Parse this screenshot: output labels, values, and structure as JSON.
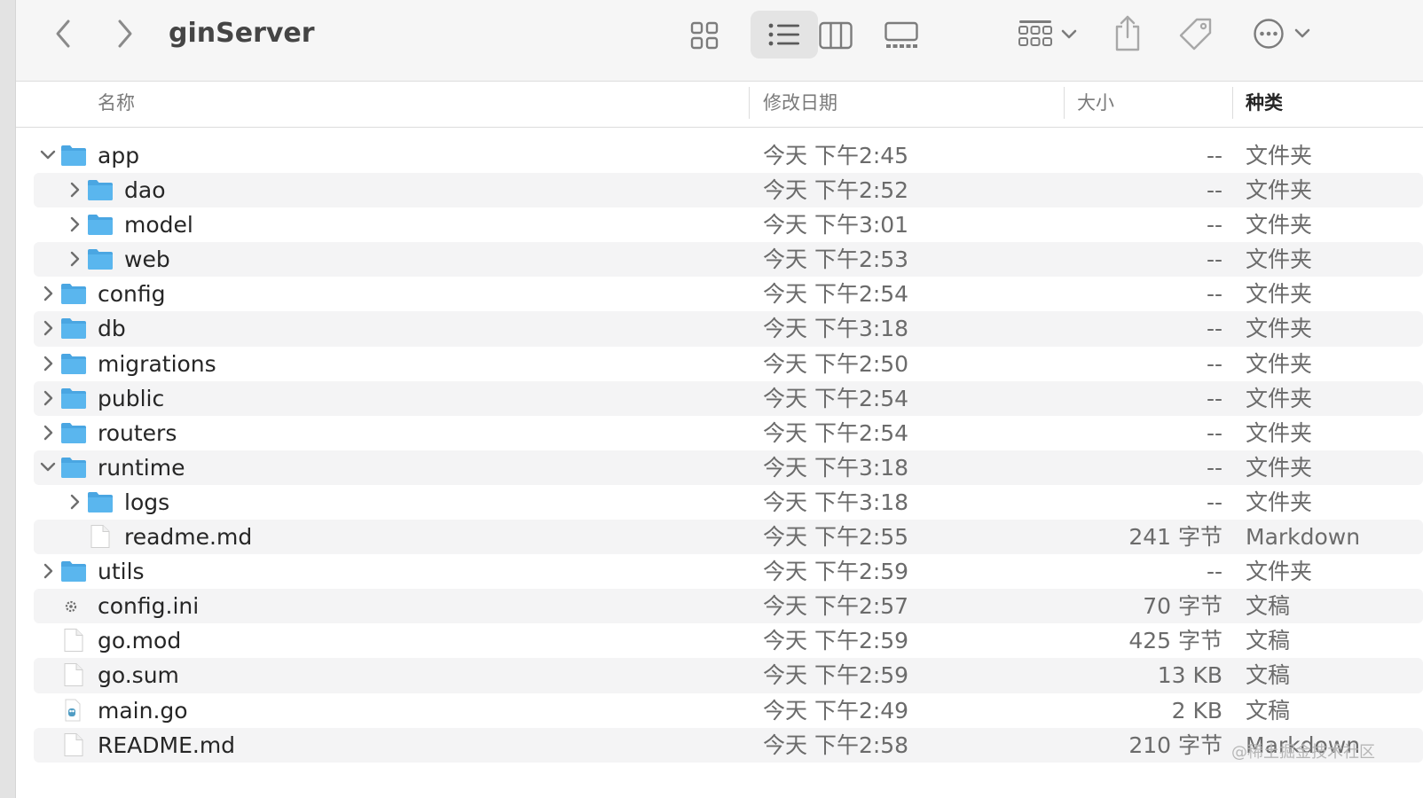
{
  "window": {
    "title": "ginServer"
  },
  "toolbar": {
    "back": "chevron-left-icon",
    "forward": "chevron-right-icon",
    "views": [
      "icon-view-icon",
      "list-view-icon",
      "column-view-icon",
      "gallery-view-icon"
    ],
    "selected_view": "list-view-icon",
    "group": "group-by-icon",
    "share": "share-icon",
    "tags": "tag-icon",
    "more": "more-options-icon"
  },
  "columns": {
    "name": "名称",
    "date": "修改日期",
    "size": "大小",
    "kind": "种类"
  },
  "sorted_column": "kind",
  "colors": {
    "folder": "#5ab6ee",
    "folder_tab": "#4aa6e2",
    "row_alt": "#f4f4f5"
  },
  "files": [
    {
      "name": "app",
      "date": "今天 下午2:45",
      "size": "--",
      "kind": "文件夹",
      "type": "folder",
      "depth": 0,
      "expanded": true
    },
    {
      "name": "dao",
      "date": "今天 下午2:52",
      "size": "--",
      "kind": "文件夹",
      "type": "folder",
      "depth": 1,
      "expanded": false
    },
    {
      "name": "model",
      "date": "今天 下午3:01",
      "size": "--",
      "kind": "文件夹",
      "type": "folder",
      "depth": 1,
      "expanded": false
    },
    {
      "name": "web",
      "date": "今天 下午2:53",
      "size": "--",
      "kind": "文件夹",
      "type": "folder",
      "depth": 1,
      "expanded": false
    },
    {
      "name": "config",
      "date": "今天 下午2:54",
      "size": "--",
      "kind": "文件夹",
      "type": "folder",
      "depth": 0,
      "expanded": false
    },
    {
      "name": "db",
      "date": "今天 下午3:18",
      "size": "--",
      "kind": "文件夹",
      "type": "folder",
      "depth": 0,
      "expanded": false
    },
    {
      "name": "migrations",
      "date": "今天 下午2:50",
      "size": "--",
      "kind": "文件夹",
      "type": "folder",
      "depth": 0,
      "expanded": false
    },
    {
      "name": "public",
      "date": "今天 下午2:54",
      "size": "--",
      "kind": "文件夹",
      "type": "folder",
      "depth": 0,
      "expanded": false
    },
    {
      "name": "routers",
      "date": "今天 下午2:54",
      "size": "--",
      "kind": "文件夹",
      "type": "folder",
      "depth": 0,
      "expanded": false
    },
    {
      "name": "runtime",
      "date": "今天 下午3:18",
      "size": "--",
      "kind": "文件夹",
      "type": "folder",
      "depth": 0,
      "expanded": true
    },
    {
      "name": "logs",
      "date": "今天 下午3:18",
      "size": "--",
      "kind": "文件夹",
      "type": "folder",
      "depth": 1,
      "expanded": false
    },
    {
      "name": "readme.md",
      "date": "今天 下午2:55",
      "size": "241 字节",
      "kind": "Markdown",
      "type": "doc",
      "depth": 1
    },
    {
      "name": "utils",
      "date": "今天 下午2:59",
      "size": "--",
      "kind": "文件夹",
      "type": "folder",
      "depth": 0,
      "expanded": false
    },
    {
      "name": "config.ini",
      "date": "今天 下午2:57",
      "size": "70 字节",
      "kind": "文稿",
      "type": "config",
      "depth": 0
    },
    {
      "name": "go.mod",
      "date": "今天 下午2:59",
      "size": "425 字节",
      "kind": "文稿",
      "type": "doc",
      "depth": 0
    },
    {
      "name": "go.sum",
      "date": "今天 下午2:59",
      "size": "13 KB",
      "kind": "文稿",
      "type": "doc",
      "depth": 0
    },
    {
      "name": "main.go",
      "date": "今天 下午2:49",
      "size": "2 KB",
      "kind": "文稿",
      "type": "go",
      "depth": 0
    },
    {
      "name": "README.md",
      "date": "今天 下午2:58",
      "size": "210 字节",
      "kind": "Markdown",
      "type": "doc",
      "depth": 0
    }
  ],
  "watermark": "@稀土掘金技术社区"
}
